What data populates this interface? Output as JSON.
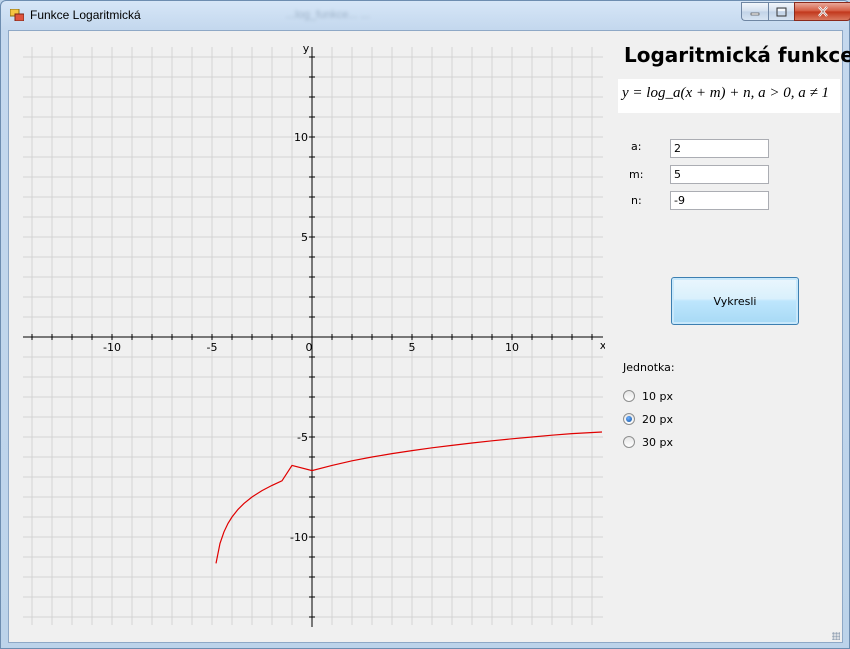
{
  "window": {
    "title": "Funkce Logaritmická",
    "ghost_title": "...log_funkce... ..."
  },
  "panel": {
    "heading": "Logaritmická funkce",
    "formula": "y = log_a(x + m) + n,   a > 0, a ≠ 1",
    "inputs": [
      {
        "label": "a:",
        "value": "2"
      },
      {
        "label": "m:",
        "value": "5"
      },
      {
        "label": "n:",
        "value": "-9"
      }
    ],
    "draw_button": "Vykresli",
    "unit_label": "Jednotka:",
    "units": [
      {
        "label": "10 px",
        "checked": false
      },
      {
        "label": "20 px",
        "checked": true
      },
      {
        "label": "30 px",
        "checked": false
      }
    ]
  },
  "chart_data": {
    "type": "line",
    "xlabel": "x",
    "ylabel": "y",
    "xlim": [
      -14.5,
      14.5
    ],
    "ylim": [
      -14.5,
      14.5
    ],
    "x_ticks": [
      -10,
      -5,
      0,
      5,
      10
    ],
    "y_ticks": [
      10,
      5,
      -5,
      -10
    ],
    "grid": true,
    "function": {
      "a": 2,
      "m": 5,
      "n": -9
    },
    "series": [
      {
        "color": "#e00000",
        "x": [
          -4.8,
          -4.6,
          -4.4,
          -4.2,
          -4.0,
          -3.7,
          -3.4,
          -3.0,
          -2.5,
          -2.0,
          -1.5,
          -1.0,
          0.0,
          1.0,
          2.0,
          3.0,
          4.0,
          5.0,
          6.0,
          7.0,
          8.0,
          9.0,
          10.0,
          11.0,
          12.0,
          13.0,
          14.5
        ],
        "y": [
          -11.32,
          -10.32,
          -9.74,
          -9.32,
          -9.0,
          -8.62,
          -8.32,
          -8.0,
          -7.68,
          -7.42,
          -7.19,
          -6.42,
          -6.68,
          -6.42,
          -6.19,
          -6.0,
          -5.83,
          -5.68,
          -5.54,
          -5.42,
          -5.3,
          -5.19,
          -5.09,
          -5.0,
          -4.91,
          -4.83,
          -4.75
        ]
      }
    ]
  }
}
